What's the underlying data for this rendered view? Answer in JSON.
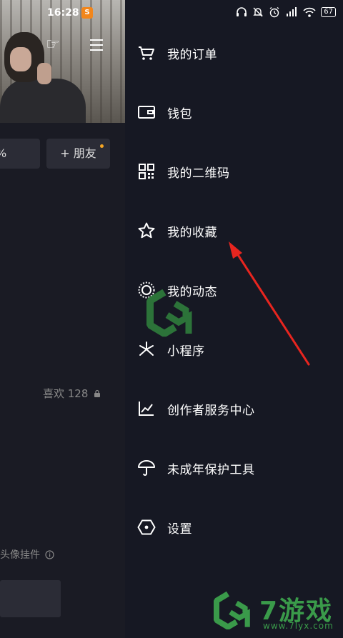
{
  "status": {
    "time": "16:28",
    "badge": "S",
    "battery": "67"
  },
  "profile": {
    "add_friend_label": "+ 朋友",
    "likes_label": "喜欢 128",
    "avatar_widget_label": "头像挂件",
    "partial_left_text": "%"
  },
  "drawer": {
    "items": [
      {
        "label": "我的订单",
        "icon": "cart-icon"
      },
      {
        "label": "钱包",
        "icon": "wallet-icon"
      },
      {
        "label": "我的二维码",
        "icon": "qr-code-icon"
      },
      {
        "label": "我的收藏",
        "icon": "star-icon"
      },
      {
        "label": "我的动态",
        "icon": "activity-circle-icon"
      },
      {
        "label": "小程序",
        "icon": "mini-program-icon"
      },
      {
        "label": "创作者服务中心",
        "icon": "chart-line-icon"
      },
      {
        "label": "未成年保护工具",
        "icon": "umbrella-icon"
      },
      {
        "label": "设置",
        "icon": "settings-hexagon-icon"
      }
    ]
  },
  "watermark": {
    "brand": "7游戏",
    "url": "www.7lyx.com"
  },
  "colors": {
    "background": "#161823",
    "annotation_arrow": "#e8251f",
    "watermark_green": "#3a9a4a"
  }
}
